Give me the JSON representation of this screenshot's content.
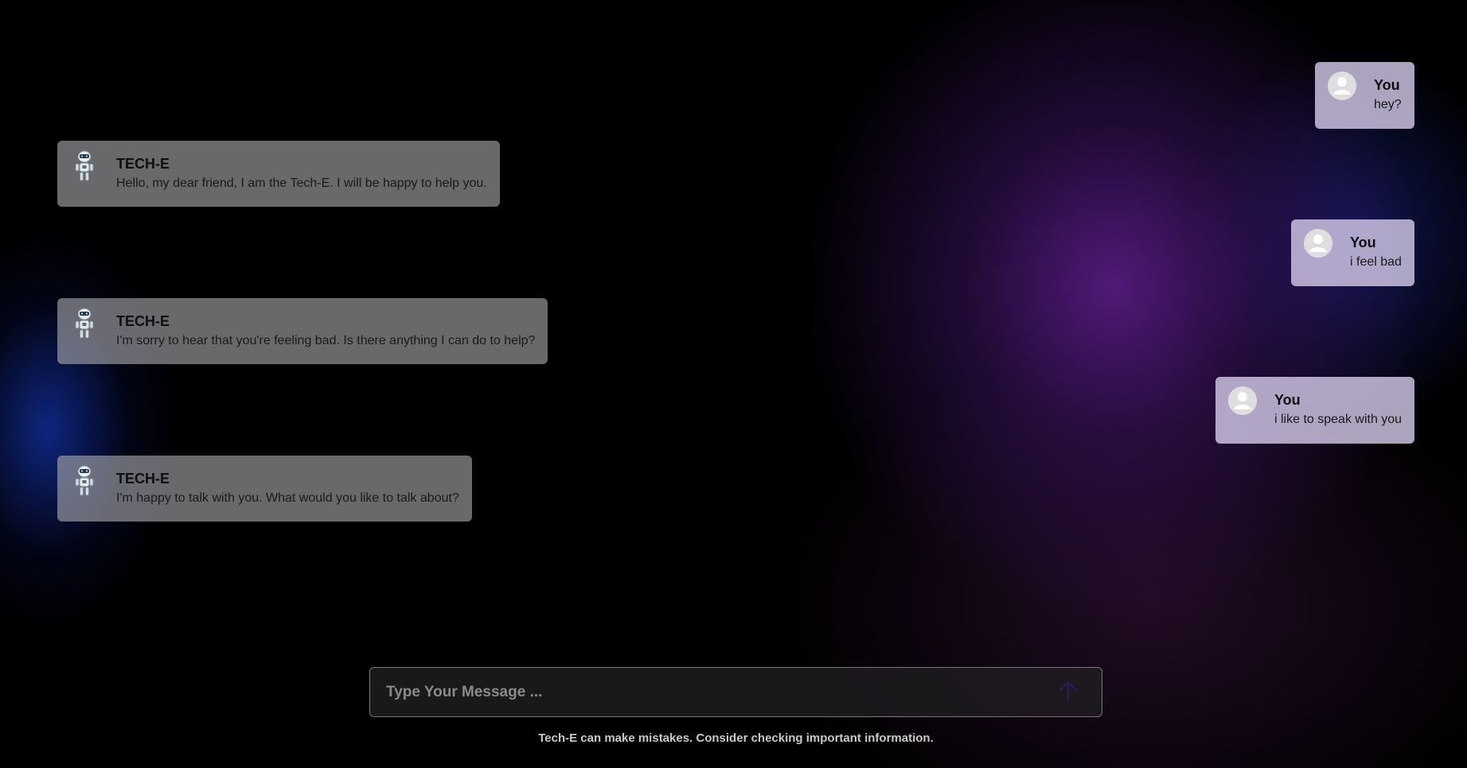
{
  "messages": [
    {
      "sender": "user",
      "name": "You",
      "text": "hey?"
    },
    {
      "sender": "bot",
      "name": "TECH-E",
      "text": "Hello, my dear friend, I am the Tech-E. I will be happy to help you."
    },
    {
      "sender": "user",
      "name": "You",
      "text": "i feel bad"
    },
    {
      "sender": "bot",
      "name": "TECH-E",
      "text": "I'm sorry to hear that you're feeling bad. Is there anything I can do to help?"
    },
    {
      "sender": "user",
      "name": "You",
      "text": "i like to speak with you"
    },
    {
      "sender": "bot",
      "name": "TECH-E",
      "text": "I'm happy to talk with you. What would you like to talk about?"
    }
  ],
  "input": {
    "placeholder": "Type Your Message ...",
    "value": ""
  },
  "send_button": {
    "icon": "arrow-up-icon"
  },
  "disclaimer": "Tech-E can make mistakes. Consider checking important information.",
  "colors": {
    "accent": "#2a1a5e",
    "bot_bubble": "#a9a9ae",
    "user_bubble": "#d2c8e6"
  }
}
